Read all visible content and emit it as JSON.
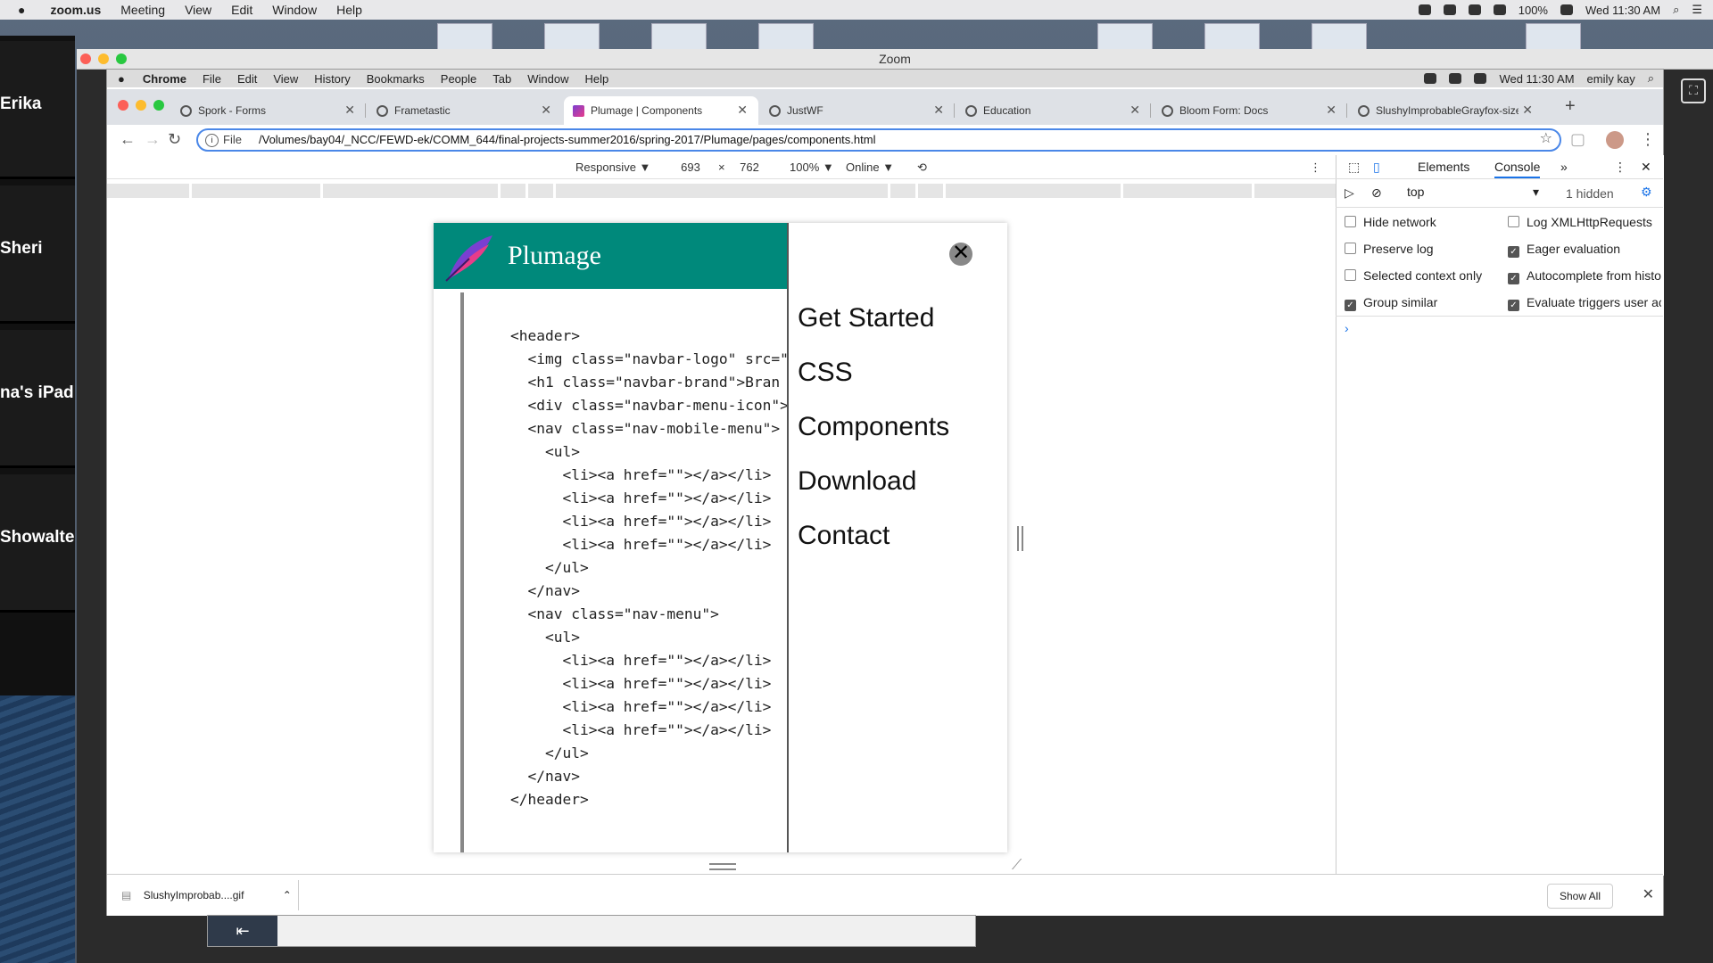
{
  "mac_menu": {
    "app": "zoom.us",
    "items": [
      "Meeting",
      "View",
      "Edit",
      "Window",
      "Help"
    ],
    "battery": "100%",
    "clock": "Wed 11:30 AM"
  },
  "zoom": {
    "window_title": "Zoom",
    "participants": [
      "Erika",
      "Sheri",
      "na's iPad",
      "Showalte"
    ]
  },
  "chrome_menu": {
    "app": "Chrome",
    "items": [
      "File",
      "Edit",
      "View",
      "History",
      "Bookmarks",
      "People",
      "Tab",
      "Window",
      "Help"
    ],
    "clock": "Wed 11:30 AM",
    "user": "emily kay"
  },
  "tabs": [
    {
      "label": "Spork - Forms"
    },
    {
      "label": "Frametastic"
    },
    {
      "label": "Plumage | Components"
    },
    {
      "label": "JustWF"
    },
    {
      "label": "Education"
    },
    {
      "label": "Bloom Form: Docs"
    },
    {
      "label": "SlushyImprobableGrayfox-size"
    }
  ],
  "address": {
    "scheme_label": "File",
    "url": "/Volumes/bay04/_NCC/FEWD-ek/COMM_644/final-projects-summer2016/spring-2017/Plumage/pages/components.html"
  },
  "device_toolbar": {
    "mode": "Responsive ▼",
    "width": "693",
    "times": "×",
    "height": "762",
    "zoom": "100% ▼",
    "network": "Online ▼"
  },
  "page": {
    "brand": "Plumage",
    "code_lines": [
      "<header>",
      "  <img class=\"navbar-logo\" src=\"",
      "  <h1 class=\"navbar-brand\">Bran",
      "  <div class=\"navbar-menu-icon\">",
      "  <nav class=\"nav-mobile-menu\">",
      "    <ul>",
      "      <li><a href=\"\"></a></li>",
      "      <li><a href=\"\"></a></li>",
      "      <li><a href=\"\"></a></li>",
      "      <li><a href=\"\"></a></li>",
      "    </ul>",
      "  </nav>",
      "  <nav class=\"nav-menu\">",
      "    <ul>",
      "      <li><a href=\"\"></a></li>",
      "      <li><a href=\"\"></a></li>",
      "      <li><a href=\"\"></a></li>",
      "      <li><a href=\"\"></a></li>",
      "    </ul>",
      "  </nav>",
      "</header>"
    ],
    "menu_close": "✕",
    "menu_items": [
      "Get Started",
      "CSS",
      "Components",
      "Download",
      "Contact"
    ]
  },
  "devtools": {
    "tabs": [
      "Elements",
      "Console"
    ],
    "more": "»",
    "context": "top",
    "hidden": "1 hidden",
    "options": [
      {
        "label": "Hide network",
        "checked": false
      },
      {
        "label": "Log XMLHttpRequests",
        "checked": false
      },
      {
        "label": "Preserve log",
        "checked": false
      },
      {
        "label": "Eager evaluation",
        "checked": true
      },
      {
        "label": "Selected context only",
        "checked": false
      },
      {
        "label": "Autocomplete from histo",
        "checked": true
      },
      {
        "label": "Group similar",
        "checked": true
      },
      {
        "label": "Evaluate triggers user ac",
        "checked": true
      }
    ],
    "prompt": "›"
  },
  "downloads": {
    "file": "SlushyImprobab....gif",
    "show_all": "Show All"
  },
  "colors": {
    "brand_teal": "#00897b",
    "accent_blue": "#1a73e8"
  }
}
